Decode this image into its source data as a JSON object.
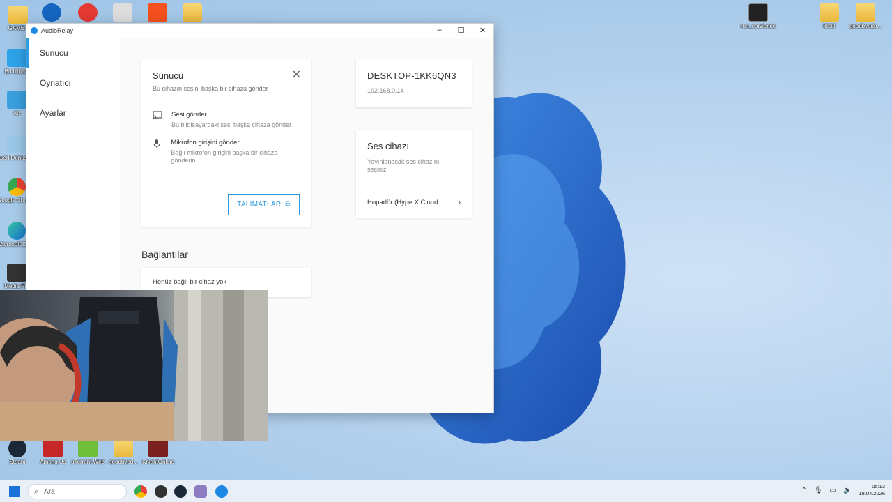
{
  "window": {
    "title": "AudioRelay",
    "controls": {
      "minimize": "–",
      "maximize": "☐",
      "close": "✕"
    }
  },
  "sidebar": {
    "items": [
      {
        "label": "Sunucu"
      },
      {
        "label": "Oynatıcı"
      },
      {
        "label": "Ayarlar"
      }
    ]
  },
  "server_card": {
    "title": "Sunucu",
    "subtitle": "Bu cihazın sesini başka bir cihaza gönder",
    "options": [
      {
        "title": "Sesi gönder",
        "desc": "Bu bilgisayardaki sesi başka cihaza gönder",
        "icon": "cast-icon"
      },
      {
        "title": "Mikrofon girişini gönder",
        "desc": "Bağlı mikrofon girişini başka bir cihaza gönderin",
        "icon": "mic-icon"
      }
    ],
    "button": "TALIMATLAR"
  },
  "connections": {
    "title": "Bağlantılar",
    "empty": "Henüz bağlı bir cihaz yok"
  },
  "host": {
    "name": "DESKTOP-1KK6QN3",
    "ip": "192.168.0.14"
  },
  "audio_device": {
    "title": "Ses cihazı",
    "subtitle": "Yayınlanacak ses cihazını seçiniz",
    "device": "Hoparlör (HyperX Cloud..."
  },
  "desktop_icons": [
    {
      "label": "GAMES"
    },
    {
      "label": "Bu bilgisa"
    },
    {
      "label": "Ağ"
    },
    {
      "label": "Geri Dönüşüm"
    },
    {
      "label": "Google Chrome"
    },
    {
      "label": "Microsoft Edge"
    },
    {
      "label": "Media Pla"
    },
    {
      "label": "run_corvience"
    },
    {
      "label": "klklkl"
    },
    {
      "label": "goodbyedp..."
    },
    {
      "label": "Steam"
    },
    {
      "label": "Among Us"
    },
    {
      "label": "uTorrent Web"
    },
    {
      "label": "goodbyed..."
    },
    {
      "label": "KnightOnline"
    }
  ],
  "taskbar": {
    "search_placeholder": "Ara",
    "time": "05:13",
    "date": "18.04.2026"
  },
  "colors": {
    "accent": "#2f9be0",
    "taskbar": "#e9eff6"
  }
}
